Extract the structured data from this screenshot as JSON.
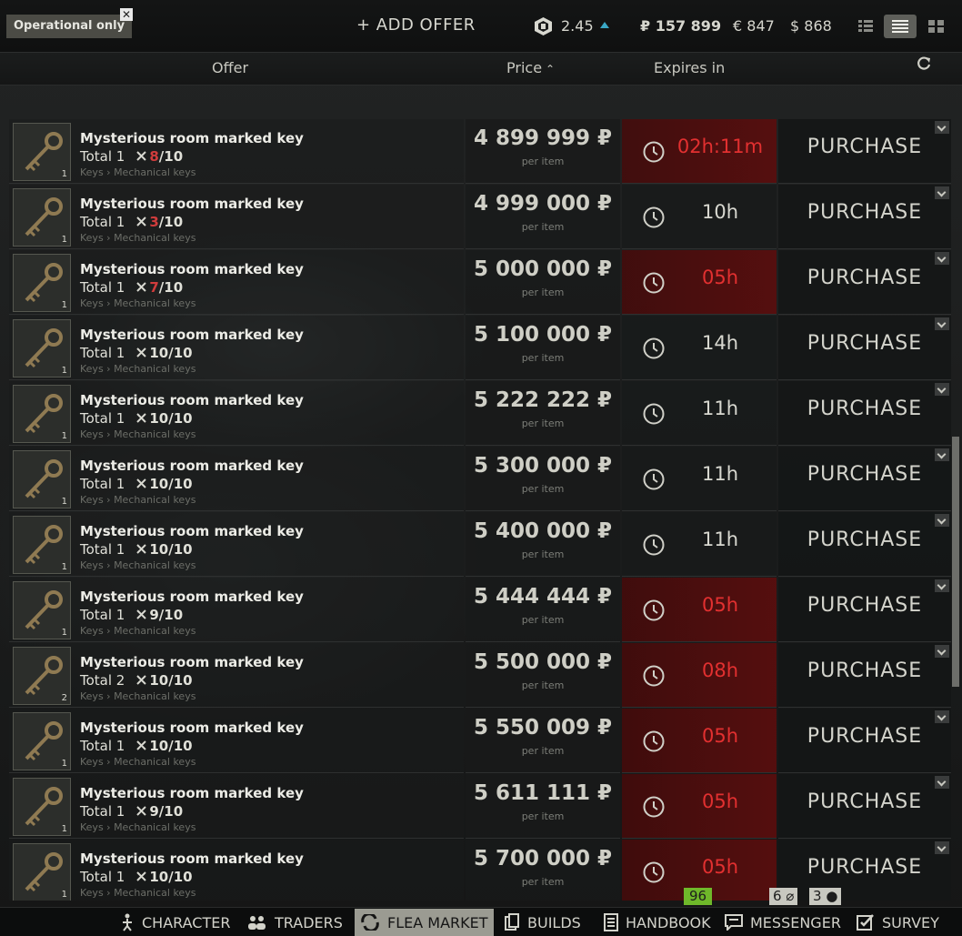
{
  "header": {
    "filter_chip": "Operational only",
    "add_offer": "+ ADD OFFER",
    "gp_value": "2.45",
    "roubles": "₽ 157 899",
    "euros": "€ 847",
    "dollars": "$ 868"
  },
  "columns": {
    "offer": "Offer",
    "price": "Price",
    "expires": "Expires in"
  },
  "offers": [
    {
      "name": "Mysterious room marked key",
      "total": "Total 1",
      "dur": "8",
      "dur_low": true,
      "dur_max": "/10",
      "category": "Keys › Mechanical keys",
      "qty": "1",
      "price": "4 899 999 ₽",
      "per_item": "per item",
      "expires": "02h:11m",
      "expires_red": true,
      "purchase": "PURCHASE"
    },
    {
      "name": "Mysterious room marked key",
      "total": "Total 1",
      "dur": "3",
      "dur_low": true,
      "dur_max": "/10",
      "category": "Keys › Mechanical keys",
      "qty": "1",
      "price": "4 999 000 ₽",
      "per_item": "per item",
      "expires": "10h",
      "expires_red": false,
      "purchase": "PURCHASE"
    },
    {
      "name": "Mysterious room marked key",
      "total": "Total 1",
      "dur": "7",
      "dur_low": true,
      "dur_max": "/10",
      "category": "Keys › Mechanical keys",
      "qty": "1",
      "price": "5 000 000 ₽",
      "per_item": "per item",
      "expires": "05h",
      "expires_red": true,
      "purchase": "PURCHASE"
    },
    {
      "name": "Mysterious room marked key",
      "total": "Total 1",
      "dur": "10",
      "dur_low": false,
      "dur_max": "/10",
      "category": "Keys › Mechanical keys",
      "qty": "1",
      "price": "5 100 000 ₽",
      "per_item": "per item",
      "expires": "14h",
      "expires_red": false,
      "purchase": "PURCHASE"
    },
    {
      "name": "Mysterious room marked key",
      "total": "Total 1",
      "dur": "10",
      "dur_low": false,
      "dur_max": "/10",
      "category": "Keys › Mechanical keys",
      "qty": "1",
      "price": "5 222 222 ₽",
      "per_item": "per item",
      "expires": "11h",
      "expires_red": false,
      "purchase": "PURCHASE"
    },
    {
      "name": "Mysterious room marked key",
      "total": "Total 1",
      "dur": "10",
      "dur_low": false,
      "dur_max": "/10",
      "category": "Keys › Mechanical keys",
      "qty": "1",
      "price": "5 300 000 ₽",
      "per_item": "per item",
      "expires": "11h",
      "expires_red": false,
      "purchase": "PURCHASE"
    },
    {
      "name": "Mysterious room marked key",
      "total": "Total 1",
      "dur": "10",
      "dur_low": false,
      "dur_max": "/10",
      "category": "Keys › Mechanical keys",
      "qty": "1",
      "price": "5 400 000 ₽",
      "per_item": "per item",
      "expires": "11h",
      "expires_red": false,
      "purchase": "PURCHASE"
    },
    {
      "name": "Mysterious room marked key",
      "total": "Total 1",
      "dur": "9",
      "dur_low": false,
      "dur_max": "/10",
      "category": "Keys › Mechanical keys",
      "qty": "1",
      "price": "5 444 444 ₽",
      "per_item": "per item",
      "expires": "05h",
      "expires_red": true,
      "purchase": "PURCHASE"
    },
    {
      "name": "Mysterious room marked key",
      "total": "Total 2",
      "dur": "10",
      "dur_low": false,
      "dur_max": "/10",
      "category": "Keys › Mechanical keys",
      "qty": "2",
      "price": "5 500 000 ₽",
      "per_item": "per item",
      "expires": "08h",
      "expires_red": true,
      "purchase": "PURCHASE"
    },
    {
      "name": "Mysterious room marked key",
      "total": "Total 1",
      "dur": "10",
      "dur_low": false,
      "dur_max": "/10",
      "category": "Keys › Mechanical keys",
      "qty": "1",
      "price": "5 550 009 ₽",
      "per_item": "per item",
      "expires": "05h",
      "expires_red": true,
      "purchase": "PURCHASE"
    },
    {
      "name": "Mysterious room marked key",
      "total": "Total 1",
      "dur": "9",
      "dur_low": false,
      "dur_max": "/10",
      "category": "Keys › Mechanical keys",
      "qty": "1",
      "price": "5 611 111 ₽",
      "per_item": "per item",
      "expires": "05h",
      "expires_red": true,
      "purchase": "PURCHASE"
    },
    {
      "name": "Mysterious room marked key",
      "total": "Total 1",
      "dur": "10",
      "dur_low": false,
      "dur_max": "/10",
      "category": "Keys › Mechanical keys",
      "qty": "1",
      "price": "5 700 000 ₽",
      "per_item": "per item",
      "expires": "05h",
      "expires_red": true,
      "purchase": "PURCHASE"
    }
  ],
  "notifications": {
    "green": "96",
    "clip": "6",
    "user": "3"
  },
  "nav": [
    {
      "label": "CHARACTER",
      "icon": "character-icon"
    },
    {
      "label": "TRADERS",
      "icon": "traders-icon"
    },
    {
      "label": "FLEA MARKET",
      "icon": "flea-market-icon",
      "active": true
    },
    {
      "label": "BUILDS",
      "icon": "builds-icon"
    },
    {
      "label": "HANDBOOK",
      "icon": "handbook-icon"
    },
    {
      "label": "MESSENGER",
      "icon": "messenger-icon"
    },
    {
      "label": "SURVEY",
      "icon": "survey-icon"
    }
  ],
  "colors": {
    "expiring_red": "#e23030",
    "low_durability": "#d03c3c",
    "gp_arrow": "#3aa7c4",
    "notification_green": "#6fb82a"
  }
}
